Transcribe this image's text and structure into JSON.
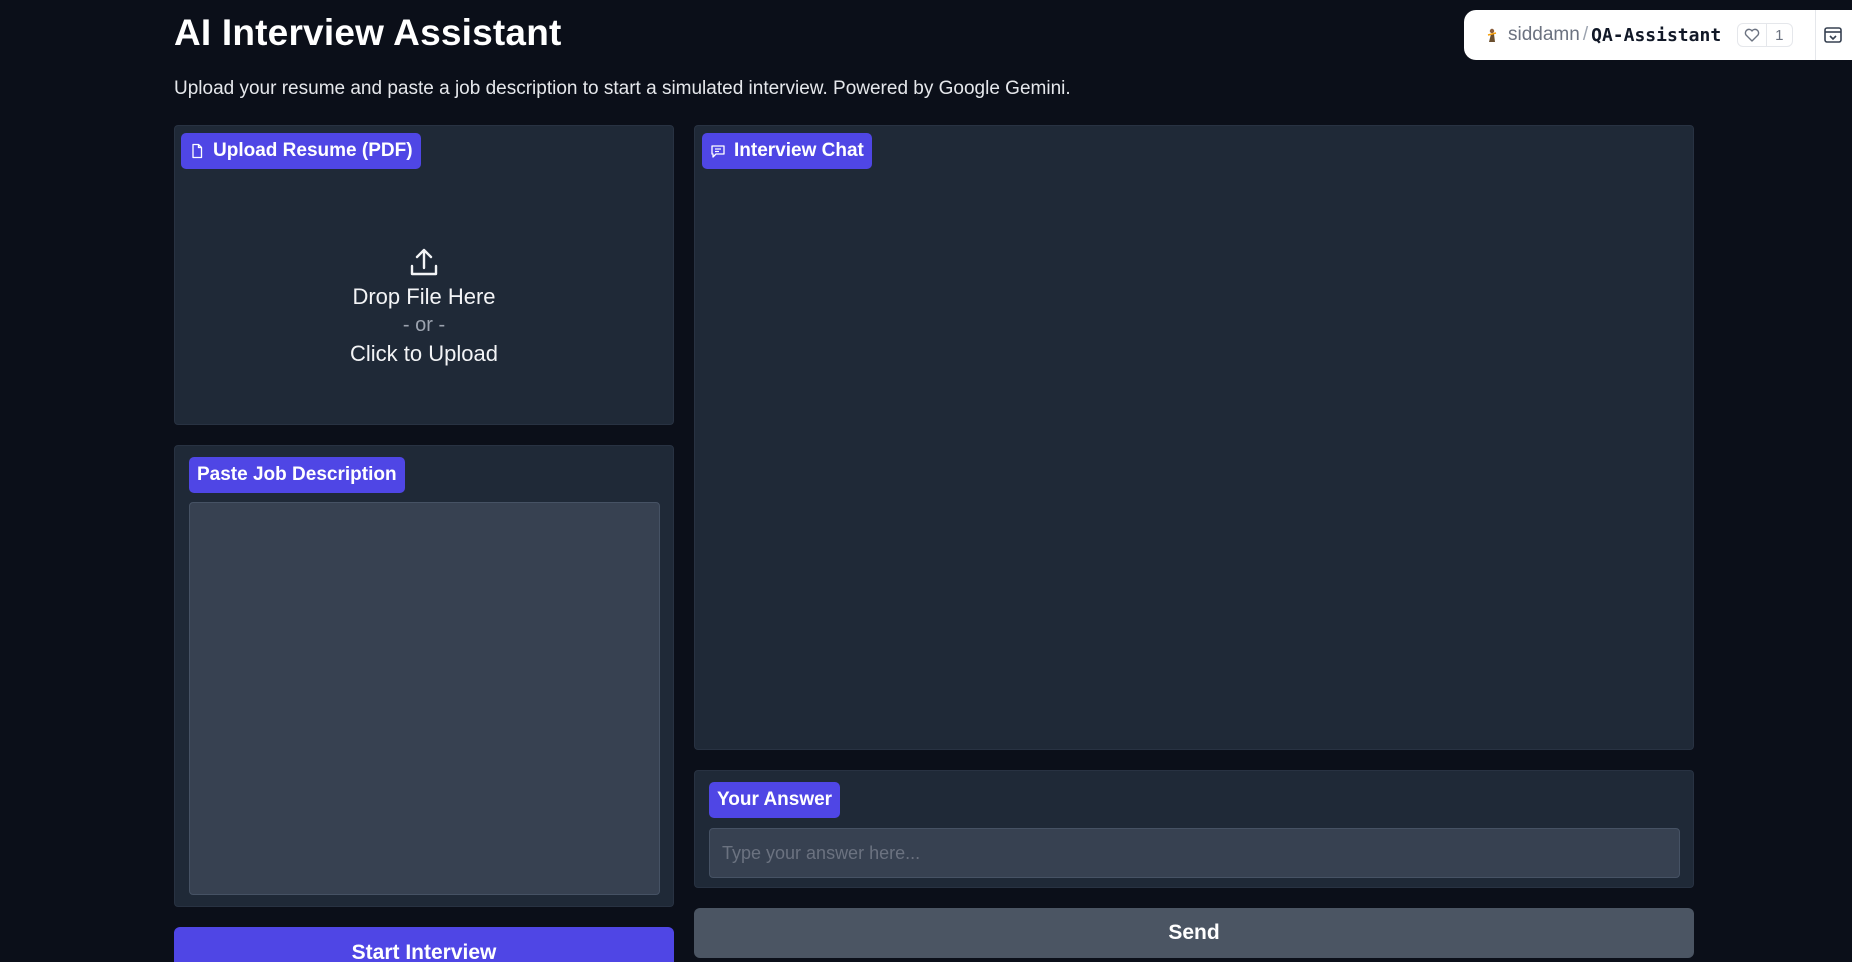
{
  "header": {
    "title": "AI Interview Assistant",
    "subtitle": "Upload your resume and paste a job description to start a simulated interview. Powered by Google Gemini."
  },
  "space_badge": {
    "user": "siddamn",
    "separator": "/",
    "repo": "QA-Assistant",
    "likes": "1"
  },
  "resume": {
    "label": "Upload Resume (PDF)",
    "drop_text": "Drop File Here",
    "or_text": "- or -",
    "click_text": "Click to Upload"
  },
  "job_description": {
    "label": "Paste Job Description",
    "value": ""
  },
  "chat": {
    "label": "Interview Chat"
  },
  "answer": {
    "label": "Your Answer",
    "placeholder": "Type your answer here...",
    "value": ""
  },
  "buttons": {
    "start": "Start Interview",
    "send": "Send"
  },
  "colors": {
    "accent": "#4f46e5",
    "background": "#0b0f19",
    "panel": "#1f2937",
    "input": "#374151",
    "secondary_button": "#4b5563"
  }
}
